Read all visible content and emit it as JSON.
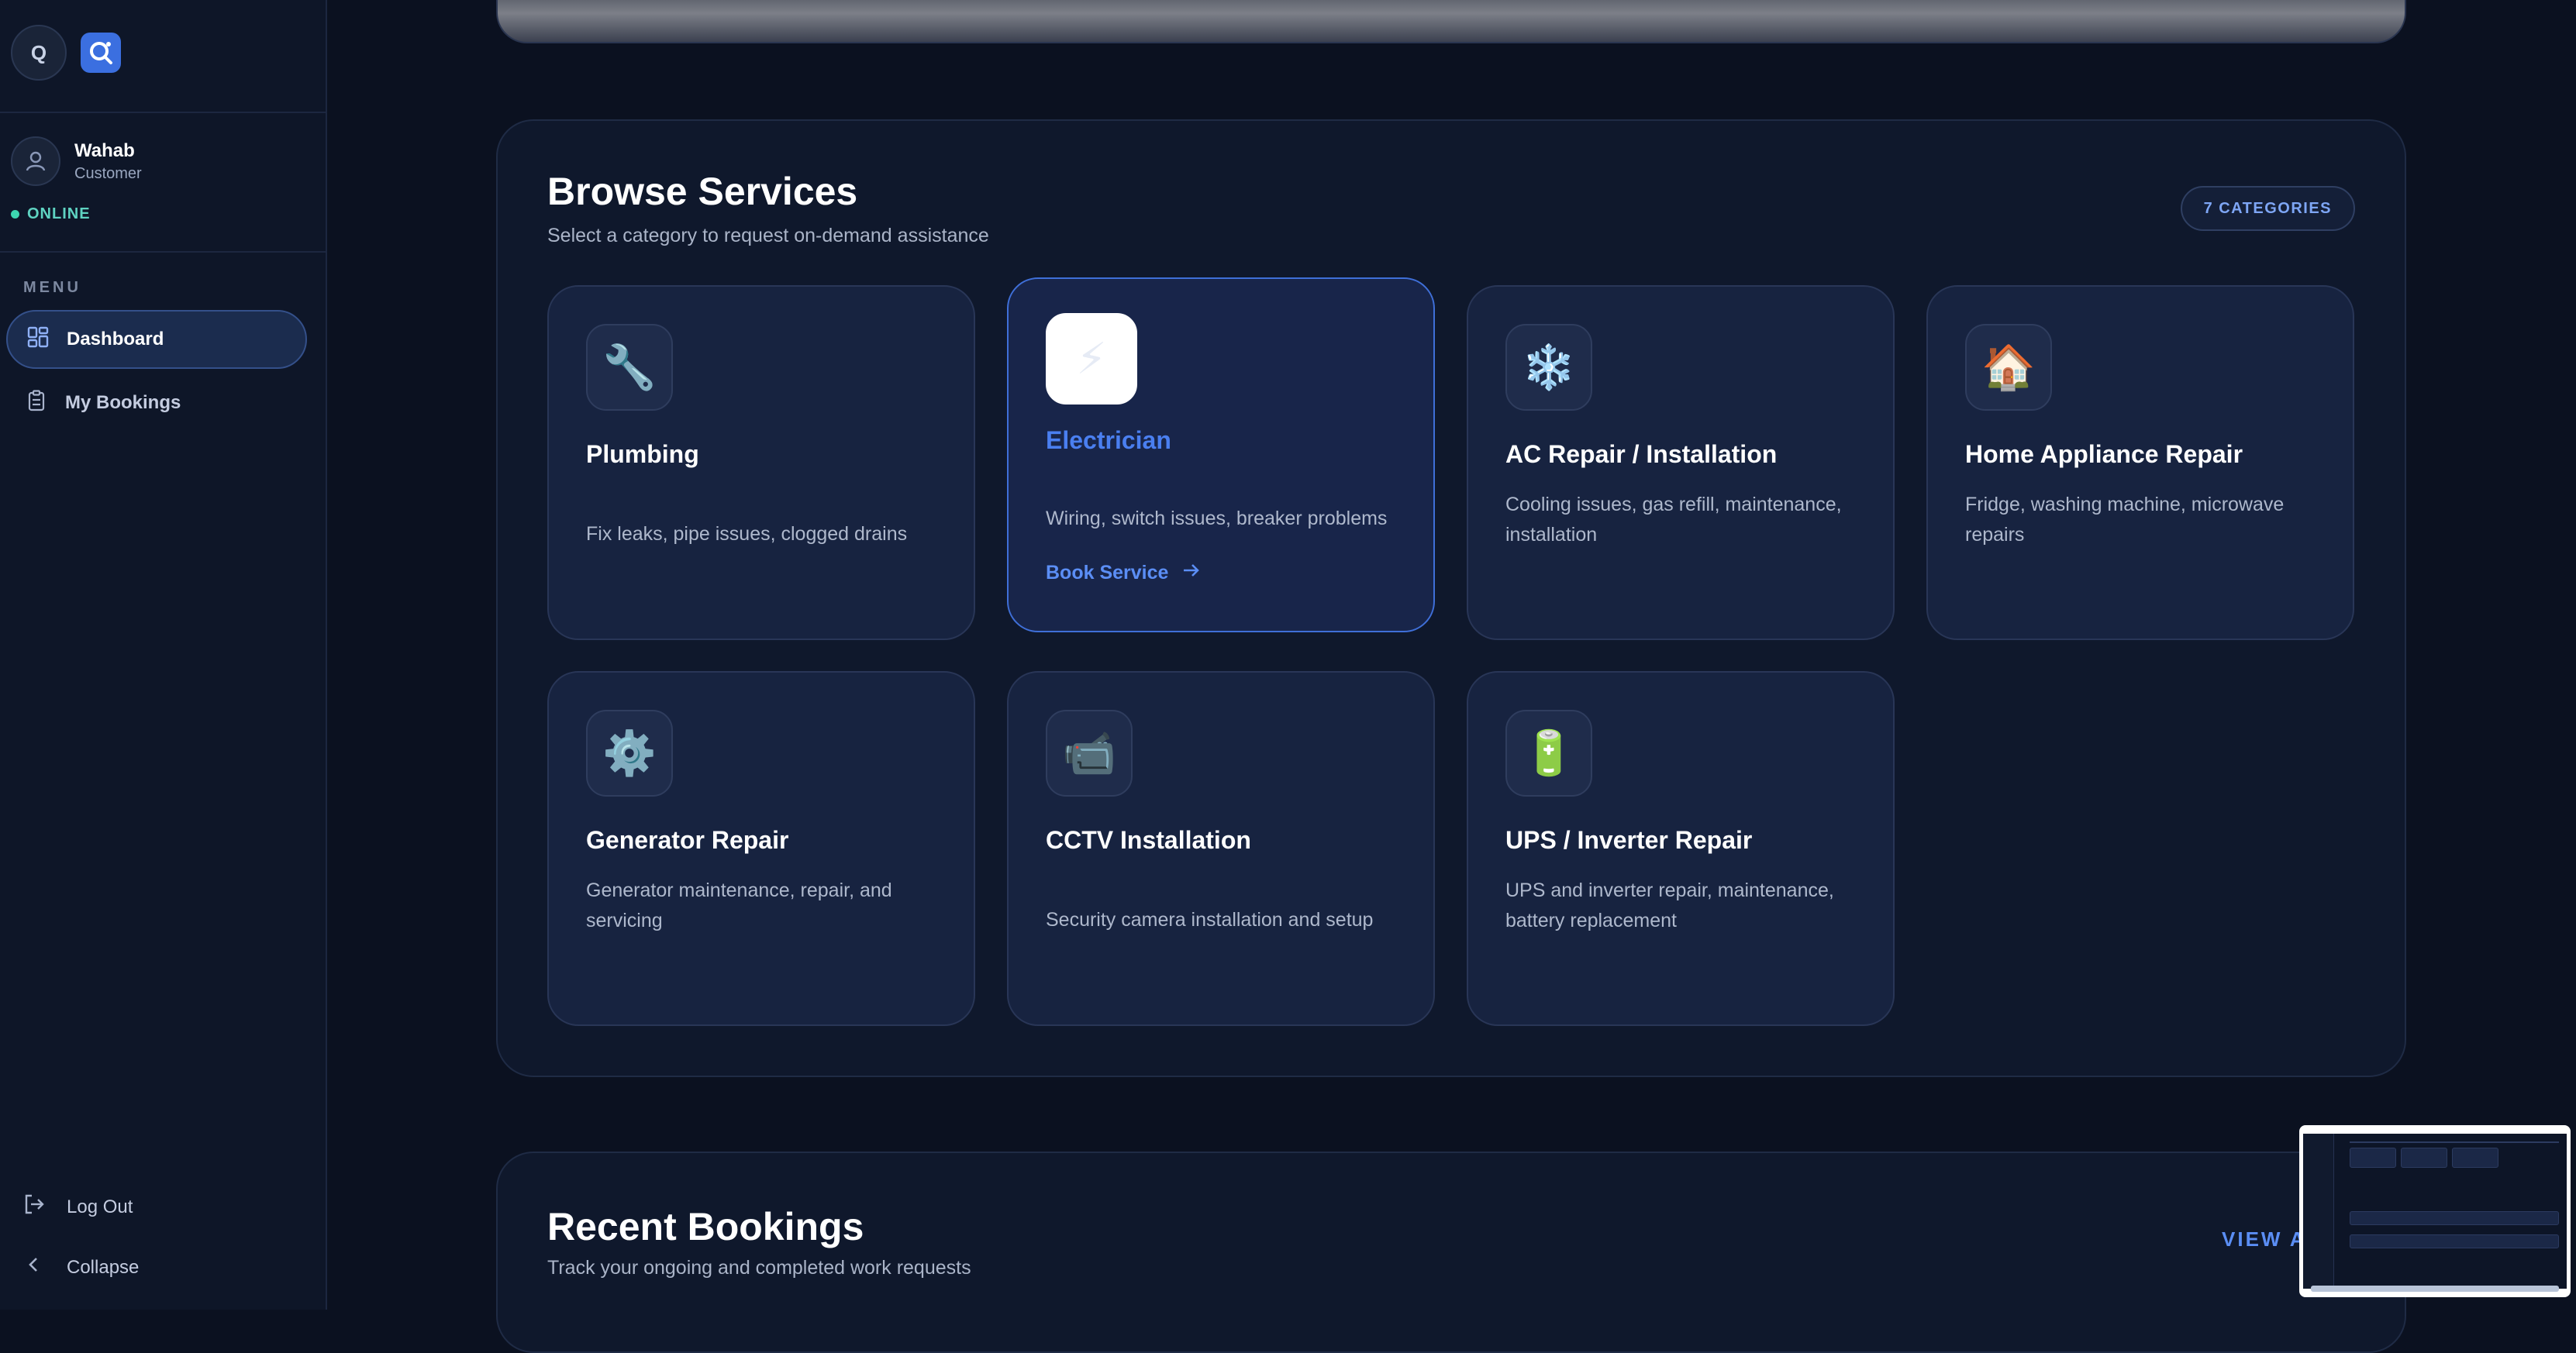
{
  "sidebar": {
    "brand_initial": "Q",
    "user": {
      "name": "Wahab",
      "role": "Customer"
    },
    "status": "ONLINE",
    "menu_heading": "MENU",
    "items": [
      {
        "label": "Dashboard",
        "icon": "grid-icon",
        "active": true
      },
      {
        "label": "My Bookings",
        "icon": "clipboard-icon",
        "active": false
      }
    ],
    "logout_label": "Log Out",
    "collapse_label": "Collapse"
  },
  "browse": {
    "title": "Browse Services",
    "subtitle": "Select a category to request on-demand assistance",
    "badge": "7 CATEGORIES",
    "book_label": "Book Service",
    "services": [
      {
        "title": "Plumbing",
        "desc": "Fix leaks, pipe issues, clogged drains",
        "icon": "🔧"
      },
      {
        "title": "Electrician",
        "desc": "Wiring, switch issues, breaker problems",
        "icon": "⚡"
      },
      {
        "title": "AC Repair / Installation",
        "desc": "Cooling issues, gas refill, maintenance, installation",
        "icon": "❄️"
      },
      {
        "title": "Home Appliance Repair",
        "desc": "Fridge, washing machine, microwave repairs",
        "icon": "🏠"
      },
      {
        "title": "Generator Repair",
        "desc": "Generator maintenance, repair, and servicing",
        "icon": "⚙️"
      },
      {
        "title": "CCTV Installation",
        "desc": "Security camera installation and setup",
        "icon": "📹"
      },
      {
        "title": "UPS / Inverter Repair",
        "desc": "UPS and inverter repair, maintenance, battery replacement",
        "icon": "🔋"
      }
    ]
  },
  "recent": {
    "title": "Recent Bookings",
    "subtitle": "Track your ongoing and completed work requests",
    "view_all": "VIEW A"
  },
  "colors": {
    "accent": "#3b6fe0",
    "background": "#0b1120",
    "online": "#3dd6b0"
  }
}
